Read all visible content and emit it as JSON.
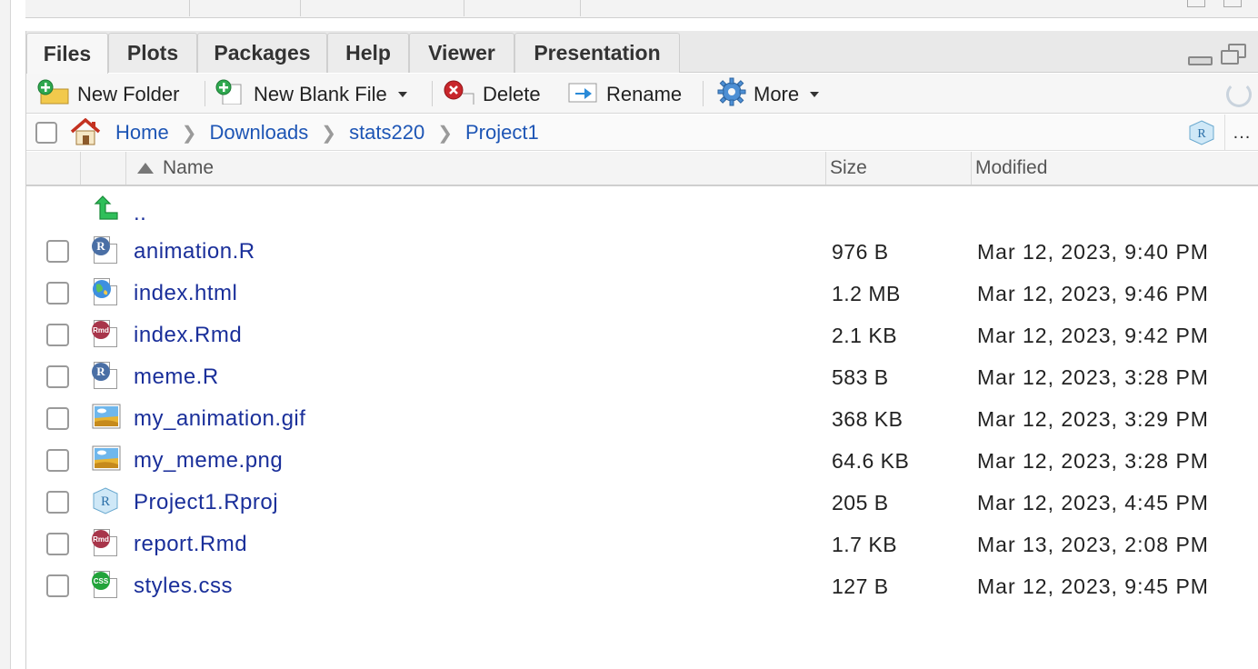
{
  "tabs": [
    {
      "label": "Files",
      "active": true
    },
    {
      "label": "Plots",
      "active": false
    },
    {
      "label": "Packages",
      "active": false
    },
    {
      "label": "Help",
      "active": false
    },
    {
      "label": "Viewer",
      "active": false
    },
    {
      "label": "Presentation",
      "active": false
    }
  ],
  "toolbar": {
    "new_folder": "New Folder",
    "new_blank_file": "New Blank File",
    "delete": "Delete",
    "rename": "Rename",
    "more": "More"
  },
  "breadcrumb": {
    "items": [
      "Home",
      "Downloads",
      "stats220",
      "Project1"
    ],
    "more_label": "..."
  },
  "table": {
    "headers": {
      "name": "Name",
      "size": "Size",
      "modified": "Modified"
    },
    "parent_label": "..",
    "rows": [
      {
        "name": "animation.R",
        "size": "976 B",
        "modified": "Mar 12, 2023, 9:40 PM",
        "icon": "r-script-icon"
      },
      {
        "name": "index.html",
        "size": "1.2 MB",
        "modified": "Mar 12, 2023, 9:46 PM",
        "icon": "html-file-icon"
      },
      {
        "name": "index.Rmd",
        "size": "2.1 KB",
        "modified": "Mar 12, 2023, 9:42 PM",
        "icon": "rmarkdown-icon"
      },
      {
        "name": "meme.R",
        "size": "583 B",
        "modified": "Mar 12, 2023, 3:28 PM",
        "icon": "r-script-icon"
      },
      {
        "name": "my_animation.gif",
        "size": "368 KB",
        "modified": "Mar 12, 2023, 3:29 PM",
        "icon": "image-file-icon"
      },
      {
        "name": "my_meme.png",
        "size": "64.6 KB",
        "modified": "Mar 12, 2023, 3:28 PM",
        "icon": "image-file-icon"
      },
      {
        "name": "Project1.Rproj",
        "size": "205 B",
        "modified": "Mar 12, 2023, 4:45 PM",
        "icon": "rproj-icon"
      },
      {
        "name": "report.Rmd",
        "size": "1.7 KB",
        "modified": "Mar 13, 2023, 2:08 PM",
        "icon": "rmarkdown-icon"
      },
      {
        "name": "styles.css",
        "size": "127 B",
        "modified": "Mar 12, 2023, 9:45 PM",
        "icon": "css-file-icon"
      }
    ]
  },
  "colors": {
    "link": "#1a2f9a",
    "crumb_link": "#1d55b5",
    "r_badge": "#4a6fa5",
    "rmd_badge": "#a8354a",
    "css_badge": "#22a33a"
  }
}
